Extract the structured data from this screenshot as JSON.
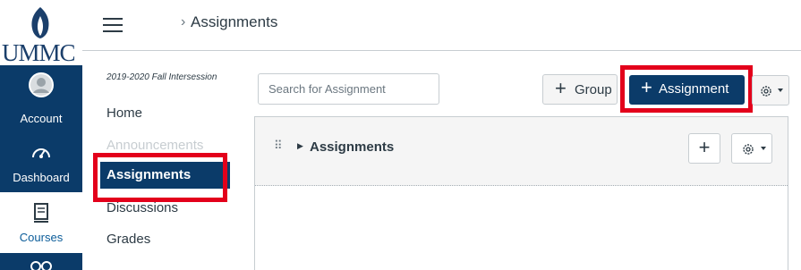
{
  "header": {
    "breadcrumb_separator": "›",
    "breadcrumb_current": "Assignments"
  },
  "global_nav": {
    "logo_text": "UMMC",
    "items": [
      {
        "label": "Account",
        "icon": "account-icon"
      },
      {
        "label": "Dashboard",
        "icon": "dashboard-icon"
      },
      {
        "label": "Courses",
        "icon": "courses-icon"
      }
    ]
  },
  "course_nav": {
    "term": "2019-2020 Fall Intersession",
    "items": [
      {
        "label": "Home"
      },
      {
        "label": "Announcements",
        "disabled": true
      },
      {
        "label": "Assignments",
        "active": true
      },
      {
        "label": "Discussions"
      },
      {
        "label": "Grades"
      }
    ]
  },
  "toolbar": {
    "search_placeholder": "Search for Assignment",
    "add_group_label": "Group",
    "add_assignment_label": "Assignment",
    "plus": "+"
  },
  "assignment_group": {
    "title": "Assignments",
    "add_label": "+"
  },
  "colors": {
    "brand_navy": "#0b3b69",
    "highlight_red": "#e3001b"
  }
}
